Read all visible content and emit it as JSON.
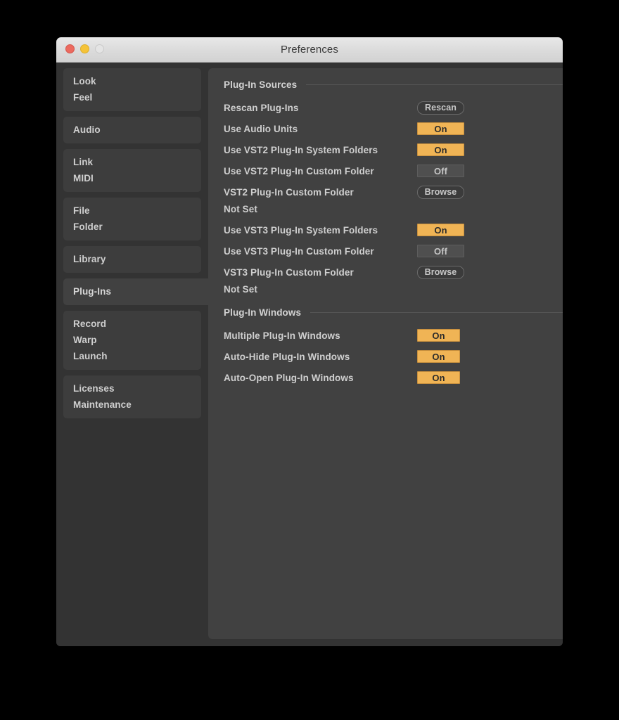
{
  "window": {
    "title": "Preferences",
    "traffic_lights": [
      "close-button",
      "minimize-button",
      "zoom-button"
    ]
  },
  "sidebar": {
    "groups": [
      {
        "id": "look-feel",
        "selected": false,
        "items": [
          "Look",
          "Feel"
        ]
      },
      {
        "id": "audio",
        "selected": false,
        "items": [
          "Audio"
        ]
      },
      {
        "id": "link-midi",
        "selected": false,
        "items": [
          "Link",
          "MIDI"
        ]
      },
      {
        "id": "file-folder",
        "selected": false,
        "items": [
          "File",
          "Folder"
        ]
      },
      {
        "id": "library",
        "selected": false,
        "items": [
          "Library"
        ]
      },
      {
        "id": "plug-ins",
        "selected": true,
        "items": [
          "Plug-Ins"
        ]
      },
      {
        "id": "record-warp-launch",
        "selected": false,
        "items": [
          "Record",
          "Warp",
          "Launch"
        ]
      },
      {
        "id": "licenses-maintenance",
        "selected": false,
        "items": [
          "Licenses",
          "Maintenance"
        ]
      }
    ]
  },
  "content": {
    "sections": [
      {
        "id": "plug-in-sources",
        "title": "Plug-In Sources",
        "rows": [
          {
            "id": "rescan-plug-ins",
            "label": "Rescan Plug-Ins",
            "control": "pill",
            "value": "Rescan"
          },
          {
            "id": "use-audio-units",
            "label": "Use Audio Units",
            "control": "toggle",
            "value": "On",
            "state": "on",
            "width": "wide"
          },
          {
            "id": "use-vst2-system-folders",
            "label": "Use VST2 Plug-In System Folders",
            "control": "toggle",
            "value": "On",
            "state": "on",
            "width": "wide"
          },
          {
            "id": "use-vst2-custom-folder",
            "label": "Use VST2 Plug-In Custom Folder",
            "control": "toggle",
            "value": "Off",
            "state": "off",
            "width": "wide"
          },
          {
            "id": "vst2-custom-folder",
            "label": "VST2 Plug-In Custom Folder",
            "control": "pill",
            "value": "Browse",
            "sub": "Not Set"
          },
          {
            "id": "use-vst3-system-folders",
            "label": "Use VST3 Plug-In System Folders",
            "control": "toggle",
            "value": "On",
            "state": "on",
            "width": "wide"
          },
          {
            "id": "use-vst3-custom-folder",
            "label": "Use VST3 Plug-In Custom Folder",
            "control": "toggle",
            "value": "Off",
            "state": "off",
            "width": "wide"
          },
          {
            "id": "vst3-custom-folder",
            "label": "VST3 Plug-In Custom Folder",
            "control": "pill",
            "value": "Browse",
            "sub": "Not Set"
          }
        ]
      },
      {
        "id": "plug-in-windows",
        "title": "Plug-In Windows",
        "rows": [
          {
            "id": "multiple-plug-in-windows",
            "label": "Multiple Plug-In Windows",
            "control": "toggle",
            "value": "On",
            "state": "on",
            "width": "narrow"
          },
          {
            "id": "auto-hide-plug-in-windows",
            "label": "Auto-Hide Plug-In Windows",
            "control": "toggle",
            "value": "On",
            "state": "on",
            "width": "narrow"
          },
          {
            "id": "auto-open-plug-in-windows",
            "label": "Auto-Open Plug-In Windows",
            "control": "toggle",
            "value": "On",
            "state": "on",
            "width": "narrow"
          }
        ]
      }
    ]
  },
  "colors": {
    "accent_on": "#f0b455",
    "window_bg": "#333333",
    "panel_bg": "#414141",
    "titlebar_bg": "#dcdcdc",
    "text": "#cfcfcf",
    "close": "#ec6a5f",
    "minimize": "#f5c338",
    "zoom": "#e4e4e4"
  }
}
